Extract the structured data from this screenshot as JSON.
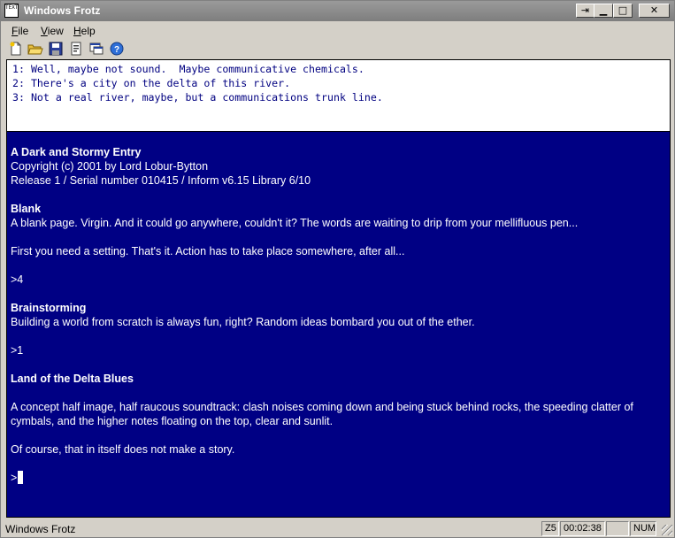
{
  "window": {
    "title": "Windows Frotz",
    "app_icon_text": "TEXT"
  },
  "titlebar_buttons": {
    "extra": "⇥",
    "minimize": "▁",
    "maximize": "□",
    "close": "✕"
  },
  "menu": {
    "file": {
      "accel": "F",
      "rest": "ile"
    },
    "view": {
      "accel": "V",
      "rest": "iew"
    },
    "help": {
      "accel": "H",
      "rest": "elp"
    }
  },
  "toolbar": {
    "icons": [
      "new-file-icon",
      "open-folder-icon",
      "save-icon",
      "properties-icon",
      "window-icon",
      "help-icon"
    ]
  },
  "upper_window": {
    "lines": [
      "1: Well, maybe not sound.  Maybe communicative chemicals.",
      "2: There's a city on the delta of this river.",
      "3: Not a real river, maybe, but a communications trunk line."
    ],
    "text_color": "#000080"
  },
  "story": {
    "background": "#000084",
    "title": "A Dark and Stormy Entry",
    "copyright": "Copyright (c) 2001 by Lord Lobur-Bytton",
    "release": "Release 1 / Serial number 010415 / Inform v6.15 Library 6/10",
    "room1_name": "Blank",
    "room1_desc": "A blank page.  Virgin.  And it could go anywhere, couldn't it?  The words are waiting to drip from your mellifluous pen...",
    "room1_note": "First you need a setting.  That's it.  Action has to take place somewhere, after all...",
    "cmd1": ">4",
    "room2_name": "Brainstorming",
    "room2_desc": "Building a world from scratch is always fun, right?  Random ideas bombard you out of the ether.",
    "cmd2": ">1",
    "room3_name": "Land of the Delta Blues",
    "room3_desc_line1": "A concept half image, half raucous soundtrack: clash noises coming down and being stuck behind rocks, the speeding clatter of",
    "room3_desc_line2": "cymbals, and the higher notes floating on the top, clear and sunlit.",
    "room3_note": "Of course, that in itself does not make a story.",
    "prompt": ">"
  },
  "statusbar": {
    "text": "Windows Frotz",
    "version": "Z5",
    "time": "00:02:38",
    "blank": "",
    "numlock": "NUM"
  }
}
